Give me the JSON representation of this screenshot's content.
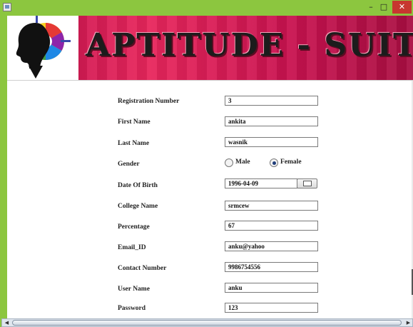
{
  "window": {
    "minimize_glyph": "–",
    "maximize_glyph": "□",
    "close_glyph": "✕"
  },
  "banner": {
    "title": "APTITUDE - SUITE",
    "logo_icon": "brain-head-logo-icon"
  },
  "form": {
    "registration_number": {
      "label": "Registration Number",
      "value": "3"
    },
    "first_name": {
      "label": "First Name",
      "value": "ankita"
    },
    "last_name": {
      "label": "Last Name",
      "value": "wasnik"
    },
    "gender": {
      "label": "Gender",
      "options": [
        "Male",
        "Female"
      ],
      "selected": "Female"
    },
    "dob": {
      "label": "Date Of Birth",
      "value": "1996-04-09",
      "button_icon": "calendar-icon"
    },
    "college_name": {
      "label": "College Name",
      "value": "srmcew"
    },
    "percentage": {
      "label": "Percentage",
      "value": "67"
    },
    "email": {
      "label": "Email_ID",
      "value": "anku@yahoo"
    },
    "contact_number": {
      "label": "Contact Number",
      "value": "9986754556"
    },
    "user_name": {
      "label": "User Name",
      "value": "anku"
    },
    "password": {
      "label": "Password",
      "value": "123"
    }
  },
  "colors": {
    "window_frame": "#8cc63f",
    "banner": "#d81b55",
    "close_button": "#c7372f"
  }
}
